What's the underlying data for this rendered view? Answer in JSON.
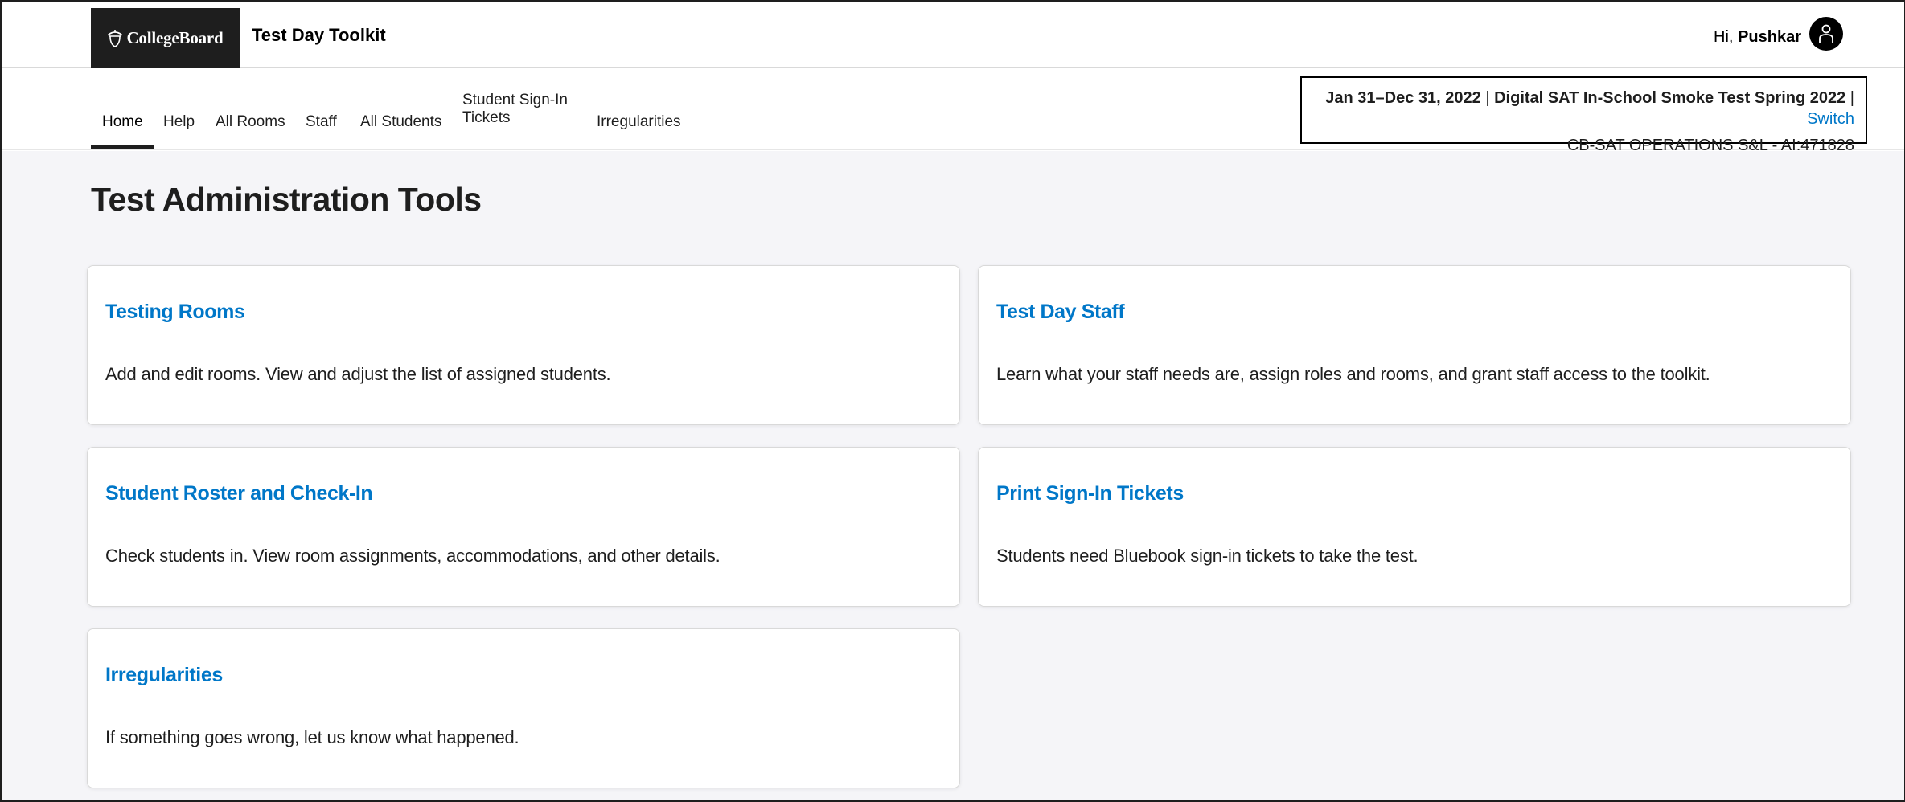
{
  "header": {
    "logo_text": "CollegeBoard",
    "app_title": "Test Day Toolkit",
    "greeting_prefix": "Hi,",
    "user_name": "Pushkar"
  },
  "nav": {
    "items": [
      {
        "label": "Home",
        "active": true
      },
      {
        "label": "Help"
      },
      {
        "label": "All Rooms"
      },
      {
        "label": "Staff"
      },
      {
        "label": "All Students"
      },
      {
        "label": "Student Sign-In Tickets"
      },
      {
        "label": "Irregularities"
      }
    ]
  },
  "event": {
    "dates": "Jan 31–Dec 31, 2022",
    "separator": "|",
    "name": "Digital SAT In-School Smoke Test Spring 2022",
    "switch_label": "Switch",
    "org": "CB-SAT OPERATIONS S&L - AI:471828"
  },
  "main": {
    "title": "Test Administration Tools",
    "cards": [
      {
        "title": "Testing Rooms",
        "description": "Add and edit rooms. View and adjust the list of assigned students."
      },
      {
        "title": "Test Day Staff",
        "description": "Learn what your staff needs are, assign roles and rooms, and grant staff access to the toolkit."
      },
      {
        "title": "Student Roster and Check-In",
        "description": "Check students in. View room assignments, accommodations, and other details."
      },
      {
        "title": "Print Sign-In Tickets",
        "description": "Students need Bluebook sign-in tickets to take the test."
      },
      {
        "title": "Irregularities",
        "description": "If something goes wrong, let us know what happened."
      }
    ]
  },
  "colors": {
    "link_blue": "#0077c8",
    "page_background": "#f5f5f8",
    "logo_background": "#1e1e1e"
  },
  "icons": {
    "logo": "acorn-icon",
    "avatar": "user-icon"
  }
}
